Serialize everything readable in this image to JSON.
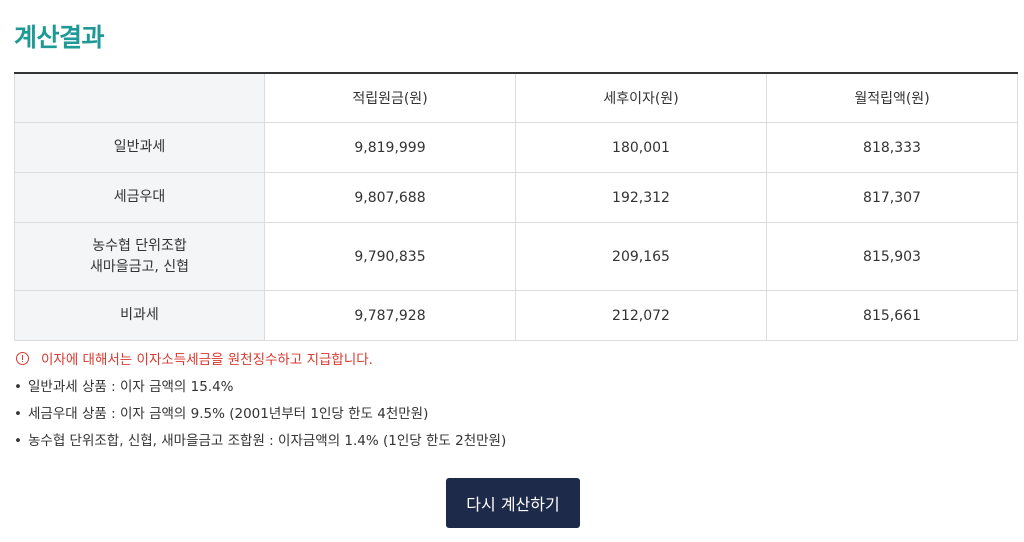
{
  "title": "계산결과",
  "table": {
    "corner": "",
    "columns": [
      "적립원금(원)",
      "세후이자(원)",
      "월적립액(원)"
    ],
    "rows": [
      {
        "label_lines": [
          "일반과세"
        ],
        "values": [
          "9,819,999",
          "180,001",
          "818,333"
        ]
      },
      {
        "label_lines": [
          "세금우대"
        ],
        "values": [
          "9,807,688",
          "192,312",
          "817,307"
        ]
      },
      {
        "label_lines": [
          "농수협 단위조합",
          "새마을금고, 신협"
        ],
        "values": [
          "9,790,835",
          "209,165",
          "815,903"
        ]
      },
      {
        "label_lines": [
          "비과세"
        ],
        "values": [
          "9,787,928",
          "212,072",
          "815,661"
        ]
      }
    ]
  },
  "notice": {
    "icon": "info-circle-icon",
    "color": "#d9392f",
    "text": "이자에 대해서는 이자소득세금을 원천징수하고 지급합니다."
  },
  "notes": [
    "일반과세 상품 : 이자 금액의 15.4%",
    "세금우대 상품 : 이자 금액의 9.5% (2001년부터 1인당 한도 4천만원)",
    "농수협 단위조합, 신협, 새마을금고 조합원 : 이자금액의 1.4% (1인당 한도 2천만원)"
  ],
  "buttons": {
    "recalculate": "다시 계산하기"
  },
  "colors": {
    "title": "#1e9a96",
    "button_bg": "#1e2a4a",
    "header_bg": "#f4f5f7"
  }
}
